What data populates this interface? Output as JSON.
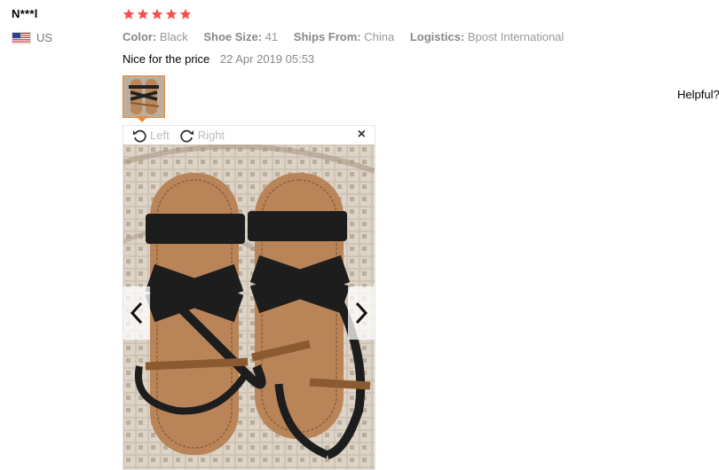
{
  "reviewer": {
    "name": "N***l",
    "country": "US"
  },
  "review": {
    "rating": 5,
    "attributes": [
      {
        "key": "Color:",
        "value": "Black"
      },
      {
        "key": "Shoe Size:",
        "value": "41"
      },
      {
        "key": "Ships From:",
        "value": "China"
      },
      {
        "key": "Logistics:",
        "value": "Bpost International"
      }
    ],
    "feedback": "Nice for the price",
    "date": "22 Apr 2019 05:53",
    "helpful_label": "Helpful?"
  },
  "viewer": {
    "rotate_left_label": "Left",
    "rotate_right_label": "Right",
    "close_glyph": "×"
  },
  "colors": {
    "star": "#f0524e",
    "thumb_border": "#e88b3a",
    "muted": "#999999"
  }
}
